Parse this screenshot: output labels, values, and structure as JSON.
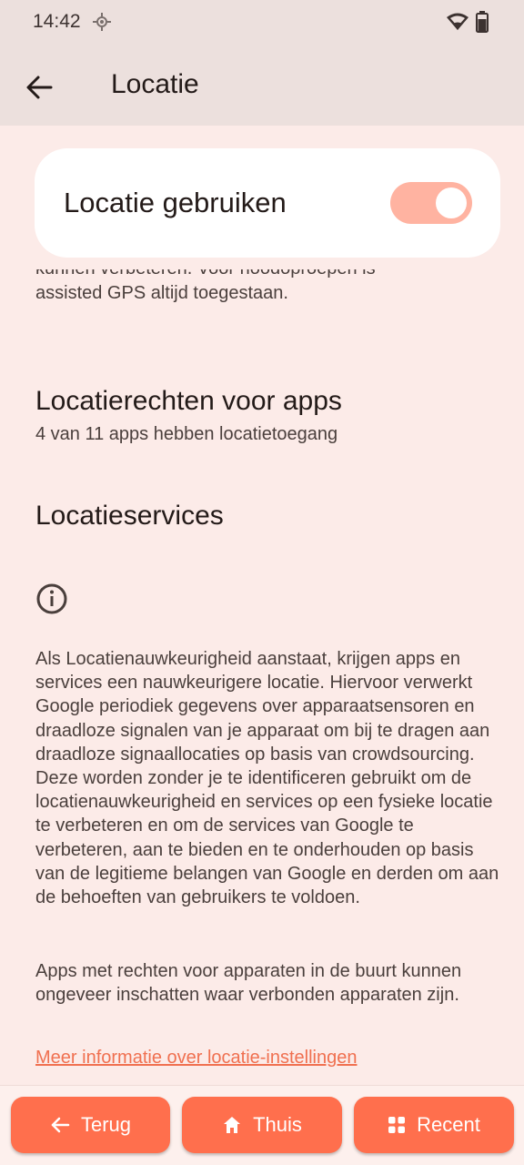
{
  "status_bar": {
    "time": "14:42",
    "icons": [
      "location-icon",
      "wifi-icon",
      "battery-icon"
    ]
  },
  "app_bar": {
    "title": "Locatie",
    "back_icon": "arrow-left-icon"
  },
  "main_switch": {
    "label": "Locatie gebruiken",
    "state": "on",
    "track_color": "#ffb3a1"
  },
  "location_description_tail": "kunnen verbeteren. Voor noodoproepen is assisted GPS altijd toegestaan.",
  "app_permissions": {
    "title": "Locatierechten voor apps",
    "subtitle": "4 van 11 apps hebben locatietoegang"
  },
  "location_services": {
    "title": "Locatieservices"
  },
  "info": {
    "icon": "info-icon",
    "paragraph_1": "Als Locatienauwkeurigheid aanstaat, krijgen apps en services een nauwkeurigere locatie. Hiervoor verwerkt Google periodiek gegevens over appa­raatsensoren en draadloze signalen van je apparaat om bij te dragen aan draadloze signaallocaties op basis van crowdsourcing. Deze worden zonder je te identificeren gebruikt om de locatienauwkeurigheid en services op een fysieke locatie te verbeteren en om de services van Google te verbeteren, aan te bieden en te onderhouden op basis van de legitieme belangen van Google en derden om aan de behoeften van gebruikers te voldoen.",
    "paragraph_2": "Apps met rechten voor apparaten in de buurt kunnen ongeveer inschatten waar verbonden apparaten zijn.",
    "learn_more_link": "Meer informatie over locatie-instellingen"
  },
  "bottom_nav": {
    "back_label": "Terug",
    "home_label": "Thuis",
    "recent_label": "Recent",
    "accent_color": "#ff6f4d"
  }
}
